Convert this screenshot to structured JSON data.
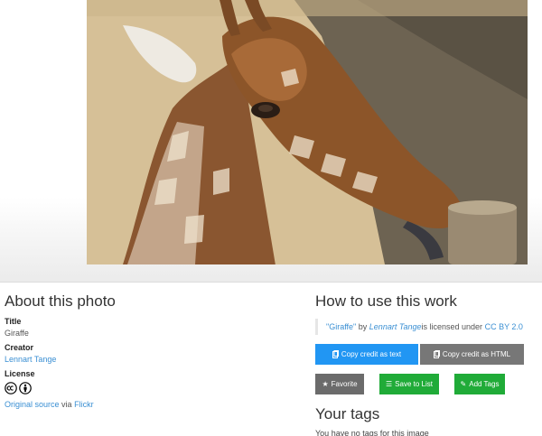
{
  "photo": {
    "alt": "Giraffe"
  },
  "about": {
    "heading": "About this photo",
    "title_label": "Title",
    "title_value": "Giraffe",
    "creator_label": "Creator",
    "creator_value": "Lennart Tange",
    "license_label": "License",
    "license_icons": [
      "cc-icon",
      "by-icon"
    ],
    "source_link": "Original source",
    "source_via": "via",
    "source_site": "Flickr"
  },
  "usage": {
    "heading": "How to use this work",
    "credit_title": "\"Giraffe\"",
    "credit_by": "by",
    "credit_author": "Lennart Tange",
    "credit_licensed": "is licensed under",
    "credit_license": "CC BY 2.0",
    "copy_text_label": "Copy credit as text",
    "copy_html_label": "Copy credit as HTML",
    "favorite_label": "Favorite",
    "save_label": "Save to List",
    "add_tags_label": "Add Tags"
  },
  "tags": {
    "heading": "Your tags",
    "empty_text": "You have no tags for this image"
  },
  "colors": {
    "link": "#3a8fd3",
    "primary": "#2196f3",
    "secondary": "#777777",
    "success": "#20ab38"
  }
}
